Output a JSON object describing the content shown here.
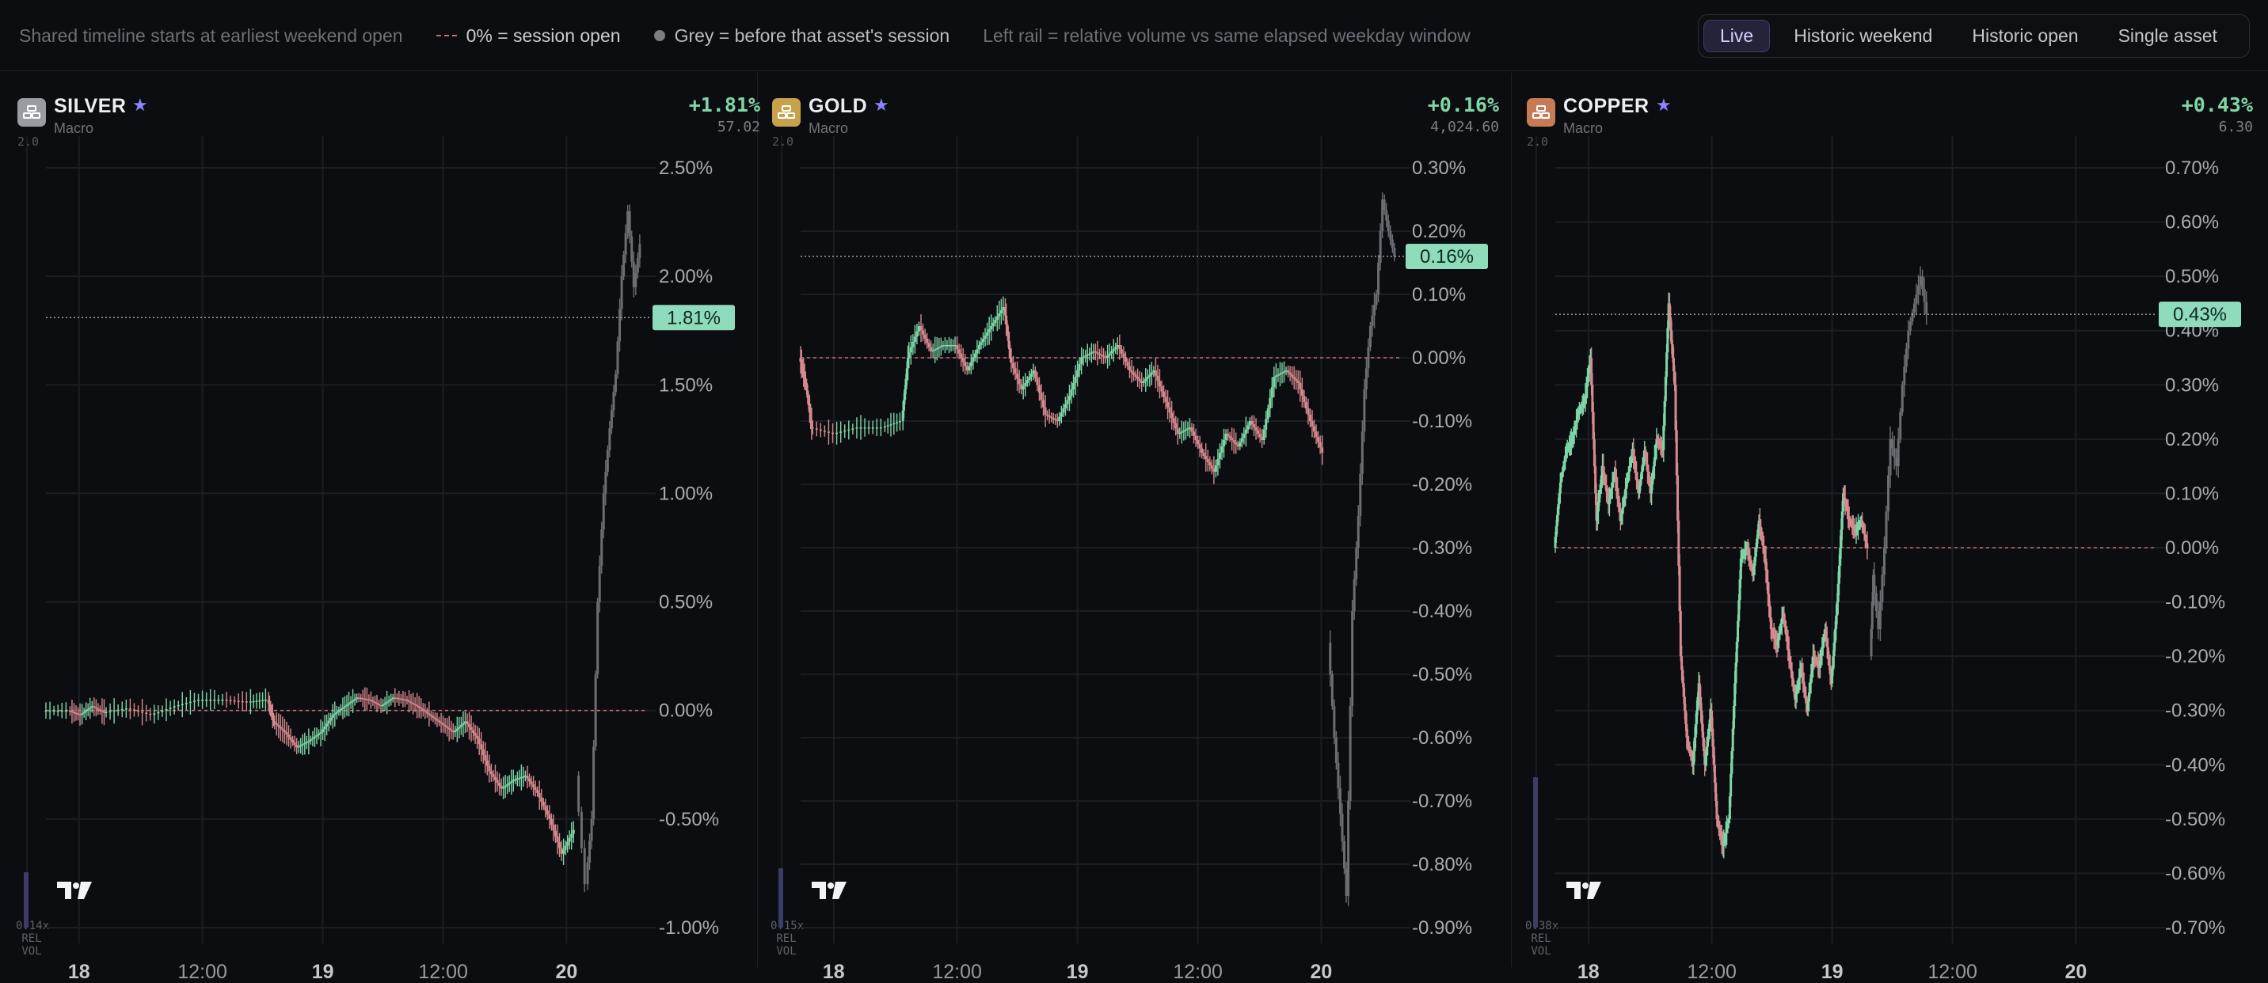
{
  "legend": {
    "timeline": "Shared timeline starts at earliest weekend open",
    "session_open": "0% = session open",
    "grey": "Grey = before that asset's session",
    "rail": "Left rail = relative volume vs same elapsed weekday window"
  },
  "modes": [
    "Live",
    "Historic weekend",
    "Historic open",
    "Single asset"
  ],
  "active_mode": "Live",
  "colors": {
    "up": "#7fd7a8",
    "down": "#d78a8f",
    "pre": "#6b6e74",
    "accent": "#8c83ff",
    "current_label_bg": "#8fdcbc"
  },
  "icons": {
    "asset": "stacked-bars-icon",
    "favorite": "star-icon",
    "brand": "tradingview-logo-icon"
  },
  "x_labels": [
    "18",
    "12:00",
    "19",
    "12:00",
    "20"
  ],
  "panels": [
    {
      "name": "SILVER",
      "star": "★",
      "category": "Macro",
      "change": "+1.81%",
      "price": "57.02",
      "icon_color": "#9a9ca3",
      "vol_top": "2.0",
      "vol_rel": "0.14x",
      "vol_rel_label": "REL",
      "vol_label": "VOL",
      "vol_level": 0.07,
      "y_min": -1.0,
      "y_max": 2.5,
      "y_ticks": [
        2.5,
        2.0,
        1.5,
        1.0,
        0.5,
        0.0,
        -0.5,
        -1.0
      ],
      "y_tick_labels": [
        "2.50%",
        "2.00%",
        "1.50%",
        "1.00%",
        "0.50%",
        "0.00%",
        "-0.50%",
        "-1.00%"
      ],
      "current": 1.81,
      "current_label": "1.81%",
      "path": [
        [
          0,
          0
        ],
        [
          0.04,
          0
        ],
        [
          0.06,
          -0.02
        ],
        [
          0.08,
          0.02
        ],
        [
          0.1,
          -0.01
        ],
        [
          0.14,
          0.01
        ],
        [
          0.18,
          -0.02
        ],
        [
          0.22,
          0.02
        ],
        [
          0.26,
          0.05
        ],
        [
          0.3,
          0.05
        ],
        [
          0.34,
          0.04
        ],
        [
          0.37,
          0.05
        ],
        [
          0.38,
          -0.05
        ],
        [
          0.4,
          -0.1
        ],
        [
          0.42,
          -0.17
        ],
        [
          0.44,
          -0.14
        ],
        [
          0.46,
          -0.1
        ],
        [
          0.48,
          -0.02
        ],
        [
          0.5,
          0.02
        ],
        [
          0.52,
          0.06
        ],
        [
          0.54,
          0.05
        ],
        [
          0.56,
          0.02
        ],
        [
          0.58,
          0.06
        ],
        [
          0.6,
          0.05
        ],
        [
          0.62,
          0.02
        ],
        [
          0.64,
          -0.02
        ],
        [
          0.66,
          -0.06
        ],
        [
          0.68,
          -0.1
        ],
        [
          0.7,
          -0.05
        ],
        [
          0.72,
          -0.13
        ],
        [
          0.74,
          -0.28
        ],
        [
          0.76,
          -0.36
        ],
        [
          0.78,
          -0.32
        ],
        [
          0.8,
          -0.3
        ],
        [
          0.82,
          -0.38
        ],
        [
          0.84,
          -0.5
        ],
        [
          0.86,
          -0.66
        ],
        [
          0.88,
          -0.55
        ]
      ],
      "pre_path": [
        [
          0.885,
          -0.3
        ],
        [
          0.9,
          -0.8
        ],
        [
          0.91,
          -0.5
        ],
        [
          0.92,
          0.5
        ],
        [
          0.93,
          1.0
        ],
        [
          0.94,
          1.3
        ],
        [
          0.95,
          1.55
        ],
        [
          0.96,
          2.0
        ],
        [
          0.97,
          2.3
        ],
        [
          0.98,
          1.95
        ],
        [
          0.99,
          2.15
        ]
      ]
    },
    {
      "name": "GOLD",
      "star": "★",
      "category": "Macro",
      "change": "+0.16%",
      "price": "4,024.60",
      "icon_color": "#c8a24a",
      "vol_top": "2.0",
      "vol_rel": "0.15x",
      "vol_rel_label": "REL",
      "vol_label": "VOL",
      "vol_level": 0.075,
      "y_min": -0.9,
      "y_max": 0.3,
      "y_ticks": [
        0.3,
        0.2,
        0.1,
        0.0,
        -0.1,
        -0.2,
        -0.3,
        -0.4,
        -0.5,
        -0.6,
        -0.7,
        -0.8,
        -0.9
      ],
      "y_tick_labels": [
        "0.30%",
        "0.20%",
        "0.10%",
        "0.00%",
        "-0.10%",
        "-0.20%",
        "-0.30%",
        "-0.40%",
        "-0.50%",
        "-0.60%",
        "-0.70%",
        "-0.80%",
        "-0.90%"
      ],
      "current": 0.16,
      "current_label": "0.16%",
      "path": [
        [
          0,
          0
        ],
        [
          0.01,
          -0.04
        ],
        [
          0.02,
          -0.11
        ],
        [
          0.06,
          -0.12
        ],
        [
          0.1,
          -0.11
        ],
        [
          0.14,
          -0.11
        ],
        [
          0.17,
          -0.1
        ],
        [
          0.18,
          0
        ],
        [
          0.2,
          0.05
        ],
        [
          0.22,
          0.01
        ],
        [
          0.24,
          0.02
        ],
        [
          0.26,
          0.02
        ],
        [
          0.28,
          -0.02
        ],
        [
          0.3,
          0.02
        ],
        [
          0.32,
          0.05
        ],
        [
          0.34,
          0.08
        ],
        [
          0.35,
          0.0
        ],
        [
          0.37,
          -0.05
        ],
        [
          0.39,
          -0.02
        ],
        [
          0.41,
          -0.09
        ],
        [
          0.43,
          -0.1
        ],
        [
          0.45,
          -0.06
        ],
        [
          0.47,
          0.0
        ],
        [
          0.49,
          0.01
        ],
        [
          0.51,
          0.0
        ],
        [
          0.53,
          0.02
        ],
        [
          0.55,
          -0.02
        ],
        [
          0.57,
          -0.04
        ],
        [
          0.59,
          -0.02
        ],
        [
          0.61,
          -0.07
        ],
        [
          0.63,
          -0.12
        ],
        [
          0.65,
          -0.11
        ],
        [
          0.67,
          -0.15
        ],
        [
          0.69,
          -0.18
        ],
        [
          0.71,
          -0.12
        ],
        [
          0.73,
          -0.14
        ],
        [
          0.75,
          -0.1
        ],
        [
          0.77,
          -0.13
        ],
        [
          0.79,
          -0.03
        ],
        [
          0.81,
          -0.02
        ],
        [
          0.83,
          -0.04
        ],
        [
          0.85,
          -0.1
        ],
        [
          0.87,
          -0.15
        ]
      ],
      "pre_path": [
        [
          0.88,
          -0.45
        ],
        [
          0.89,
          -0.6
        ],
        [
          0.9,
          -0.72
        ],
        [
          0.91,
          -0.85
        ],
        [
          0.92,
          -0.4
        ],
        [
          0.93,
          -0.25
        ],
        [
          0.94,
          -0.05
        ],
        [
          0.95,
          0.05
        ],
        [
          0.96,
          0.1
        ],
        [
          0.97,
          0.25
        ],
        [
          0.98,
          0.2
        ],
        [
          0.99,
          0.16
        ]
      ]
    },
    {
      "name": "COPPER",
      "star": "★",
      "category": "Macro",
      "change": "+0.43%",
      "price": "6.30",
      "icon_color": "#c77a56",
      "vol_top": "2.0",
      "vol_rel": "0.38x",
      "vol_rel_label": "REL",
      "vol_label": "VOL",
      "vol_level": 0.19,
      "y_min": -0.7,
      "y_max": 0.7,
      "y_ticks": [
        0.7,
        0.6,
        0.5,
        0.4,
        0.3,
        0.2,
        0.1,
        0.0,
        -0.1,
        -0.2,
        -0.3,
        -0.4,
        -0.5,
        -0.6,
        -0.7
      ],
      "y_tick_labels": [
        "0.70%",
        "0.60%",
        "0.50%",
        "0.40%",
        "0.30%",
        "0.20%",
        "0.10%",
        "0.00%",
        "-0.10%",
        "-0.20%",
        "-0.30%",
        "-0.40%",
        "-0.50%",
        "-0.60%",
        "-0.70%"
      ],
      "current": 0.43,
      "current_label": "0.43%",
      "path": [
        [
          0,
          0
        ],
        [
          0.01,
          0.12
        ],
        [
          0.02,
          0.18
        ],
        [
          0.03,
          0.2
        ],
        [
          0.04,
          0.25
        ],
        [
          0.05,
          0.27
        ],
        [
          0.06,
          0.35
        ],
        [
          0.07,
          0.05
        ],
        [
          0.08,
          0.15
        ],
        [
          0.09,
          0.08
        ],
        [
          0.1,
          0.14
        ],
        [
          0.11,
          0.05
        ],
        [
          0.12,
          0.12
        ],
        [
          0.13,
          0.18
        ],
        [
          0.14,
          0.1
        ],
        [
          0.15,
          0.18
        ],
        [
          0.16,
          0.1
        ],
        [
          0.17,
          0.2
        ],
        [
          0.18,
          0.18
        ],
        [
          0.19,
          0.45
        ],
        [
          0.2,
          0.3
        ],
        [
          0.21,
          -0.2
        ],
        [
          0.22,
          -0.35
        ],
        [
          0.23,
          -0.4
        ],
        [
          0.24,
          -0.25
        ],
        [
          0.25,
          -0.4
        ],
        [
          0.26,
          -0.3
        ],
        [
          0.27,
          -0.5
        ],
        [
          0.28,
          -0.55
        ],
        [
          0.29,
          -0.5
        ],
        [
          0.3,
          -0.25
        ],
        [
          0.31,
          -0.02
        ],
        [
          0.32,
          0.0
        ],
        [
          0.33,
          -0.05
        ],
        [
          0.34,
          0.05
        ],
        [
          0.35,
          -0.02
        ],
        [
          0.36,
          -0.15
        ],
        [
          0.37,
          -0.18
        ],
        [
          0.38,
          -0.12
        ],
        [
          0.39,
          -0.2
        ],
        [
          0.4,
          -0.28
        ],
        [
          0.41,
          -0.22
        ],
        [
          0.42,
          -0.3
        ],
        [
          0.43,
          -0.2
        ],
        [
          0.44,
          -0.22
        ],
        [
          0.45,
          -0.15
        ],
        [
          0.46,
          -0.25
        ],
        [
          0.47,
          -0.1
        ],
        [
          0.48,
          0.1
        ],
        [
          0.49,
          0.05
        ],
        [
          0.5,
          0.03
        ],
        [
          0.51,
          0.05
        ],
        [
          0.52,
          0.0
        ]
      ],
      "pre_path": [
        [
          0.525,
          -0.2
        ],
        [
          0.53,
          -0.05
        ],
        [
          0.54,
          -0.15
        ],
        [
          0.55,
          0.0
        ],
        [
          0.56,
          0.2
        ],
        [
          0.57,
          0.15
        ],
        [
          0.58,
          0.3
        ],
        [
          0.59,
          0.4
        ],
        [
          0.6,
          0.45
        ],
        [
          0.61,
          0.5
        ],
        [
          0.62,
          0.43
        ]
      ]
    }
  ]
}
